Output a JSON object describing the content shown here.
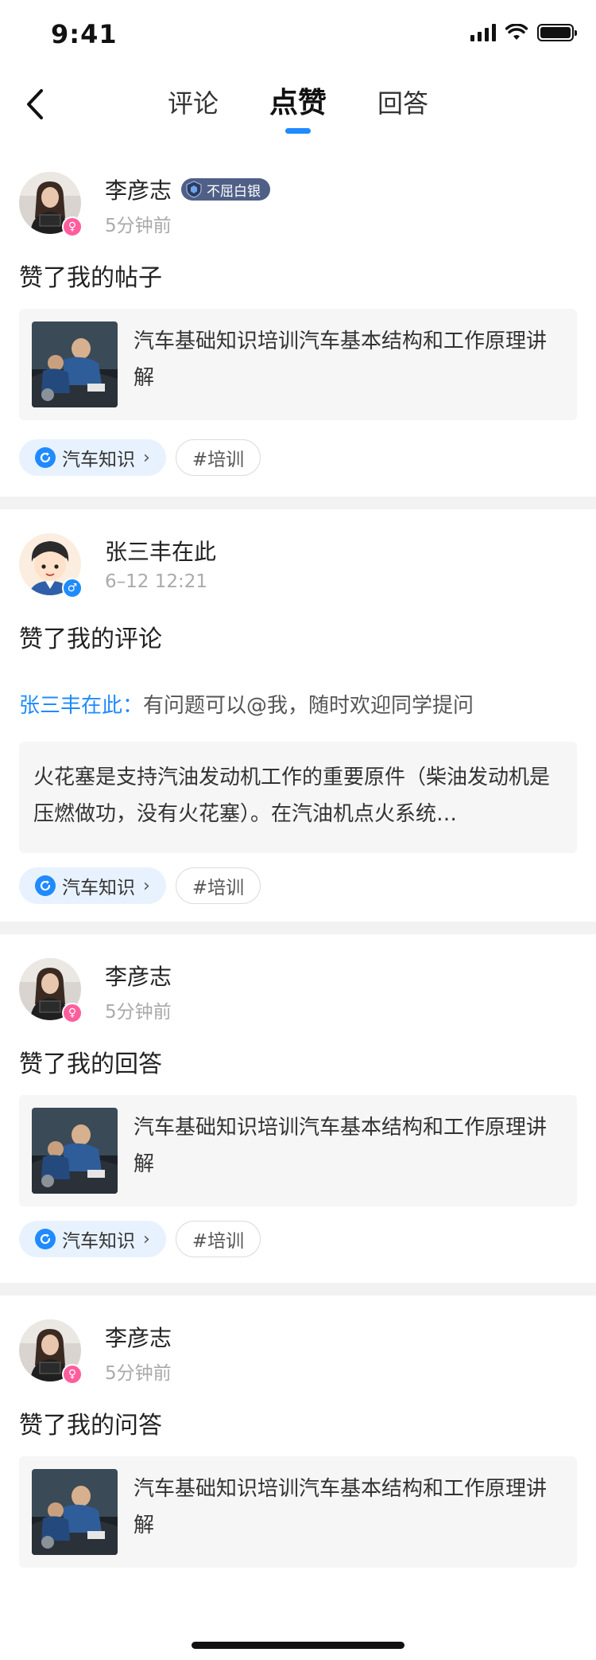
{
  "status_bar": {
    "time": "9:41"
  },
  "tabs": [
    {
      "label": "评论",
      "active": false
    },
    {
      "label": "点赞",
      "active": true
    },
    {
      "label": "回答",
      "active": false
    }
  ],
  "accent_color": "#1f8bff",
  "items": [
    {
      "user": "李彦志",
      "badge": "不屈白银",
      "time": "5分钟前",
      "gender": "female",
      "action": "赞了我的帖子",
      "quote_title": "汽车基础知识培训汽车基本结构和工作原理讲解",
      "topic_tag": "汽车知识",
      "hash_tag": "#培训"
    },
    {
      "user": "张三丰在此",
      "time": "6–12 12:21",
      "gender": "male",
      "action": "赞了我的评论",
      "reply_author": "张三丰在此：",
      "reply_text": "有问题可以@我，随时欢迎同学提问",
      "comment_text": "火花塞是支持汽油发动机工作的重要原件（柴油发动机是压燃做功，没有火花塞）。在汽油机点火系统…",
      "topic_tag": "汽车知识",
      "hash_tag": "#培训"
    },
    {
      "user": "李彦志",
      "time": "5分钟前",
      "gender": "female",
      "action": "赞了我的回答",
      "quote_title": "汽车基础知识培训汽车基本结构和工作原理讲解",
      "topic_tag": "汽车知识",
      "hash_tag": "#培训"
    },
    {
      "user": "李彦志",
      "time": "5分钟前",
      "gender": "female",
      "action": "赞了我的问答",
      "quote_title": "汽车基础知识培训汽车基本结构和工作原理讲解"
    }
  ]
}
